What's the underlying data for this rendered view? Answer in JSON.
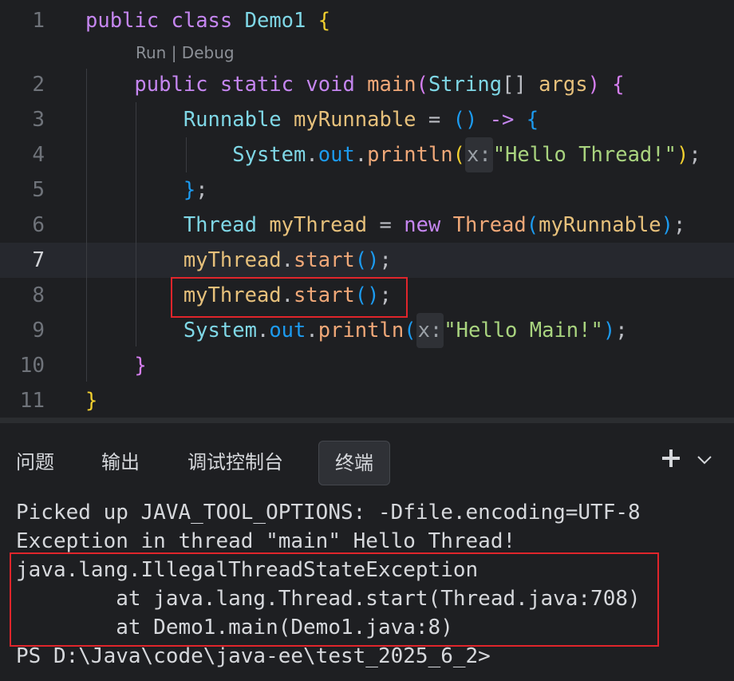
{
  "editor": {
    "line_numbers": [
      "1",
      "2",
      "3",
      "4",
      "5",
      "6",
      "7",
      "8",
      "9",
      "10",
      "11"
    ],
    "code_lens": "Run | Debug",
    "current_line": "7",
    "lines": {
      "l1": [
        "public",
        "class",
        "Demo1",
        "{"
      ],
      "l2": [
        "public",
        "static",
        "void",
        "main",
        "(",
        "String",
        "[]",
        "args",
        ")",
        "{"
      ],
      "l3": [
        "Runnable",
        "myRunnable",
        "=",
        "()",
        "->",
        "{"
      ],
      "l4": [
        "System",
        ".",
        "out",
        ".",
        "println",
        "(",
        "x:",
        "\"Hello Thread!\"",
        ")",
        ";"
      ],
      "l5": [
        "}",
        ";"
      ],
      "l6": [
        "Thread",
        "myThread",
        "=",
        "new",
        "Thread",
        "(",
        "myRunnable",
        ")",
        ";"
      ],
      "l7": [
        "myThread",
        ".",
        "start",
        "()",
        ";"
      ],
      "l8": [
        "myThread",
        ".",
        "start",
        "()",
        ";"
      ],
      "l9": [
        "System",
        ".",
        "out",
        ".",
        "println",
        "(",
        "x:",
        "\"Hello Main!\"",
        ")",
        ";"
      ],
      "l10": [
        "}"
      ],
      "l11": [
        "}"
      ]
    }
  },
  "panel": {
    "tabs": [
      "问题",
      "输出",
      "调试控制台",
      "终端"
    ],
    "active_tab": "终端",
    "add_icon": "plus-icon",
    "menu_icon": "chevron-down-icon"
  },
  "terminal": {
    "lines": [
      "Picked up JAVA_TOOL_OPTIONS: -Dfile.encoding=UTF-8",
      "Exception in thread \"main\" Hello Thread!",
      "java.lang.IllegalThreadStateException",
      "        at java.lang.Thread.start(Thread.java:708)",
      "        at Demo1.main(Demo1.java:8)",
      "PS D:\\Java\\code\\java-ee\\test_2025_6_2>"
    ]
  },
  "colors": {
    "background": "#1e1f22",
    "highlight_box": "#e0252b",
    "current_line": "#26282e"
  }
}
